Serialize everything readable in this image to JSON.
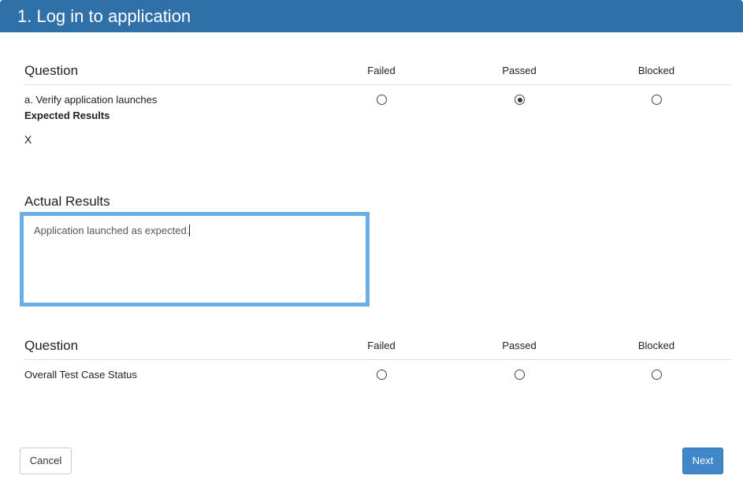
{
  "header": {
    "title": "1. Log in to application"
  },
  "columns": [
    "Failed",
    "Passed",
    "Blocked"
  ],
  "section1": {
    "question_label": "Question",
    "item": "a. Verify application launches",
    "selected": "Passed",
    "expected_label": "Expected Results",
    "expected_value": "X"
  },
  "actual": {
    "label": "Actual Results",
    "value": "Application launched as expected."
  },
  "section2": {
    "question_label": "Question",
    "item": "Overall Test Case Status",
    "selected": null
  },
  "buttons": {
    "cancel": "Cancel",
    "next": "Next"
  }
}
